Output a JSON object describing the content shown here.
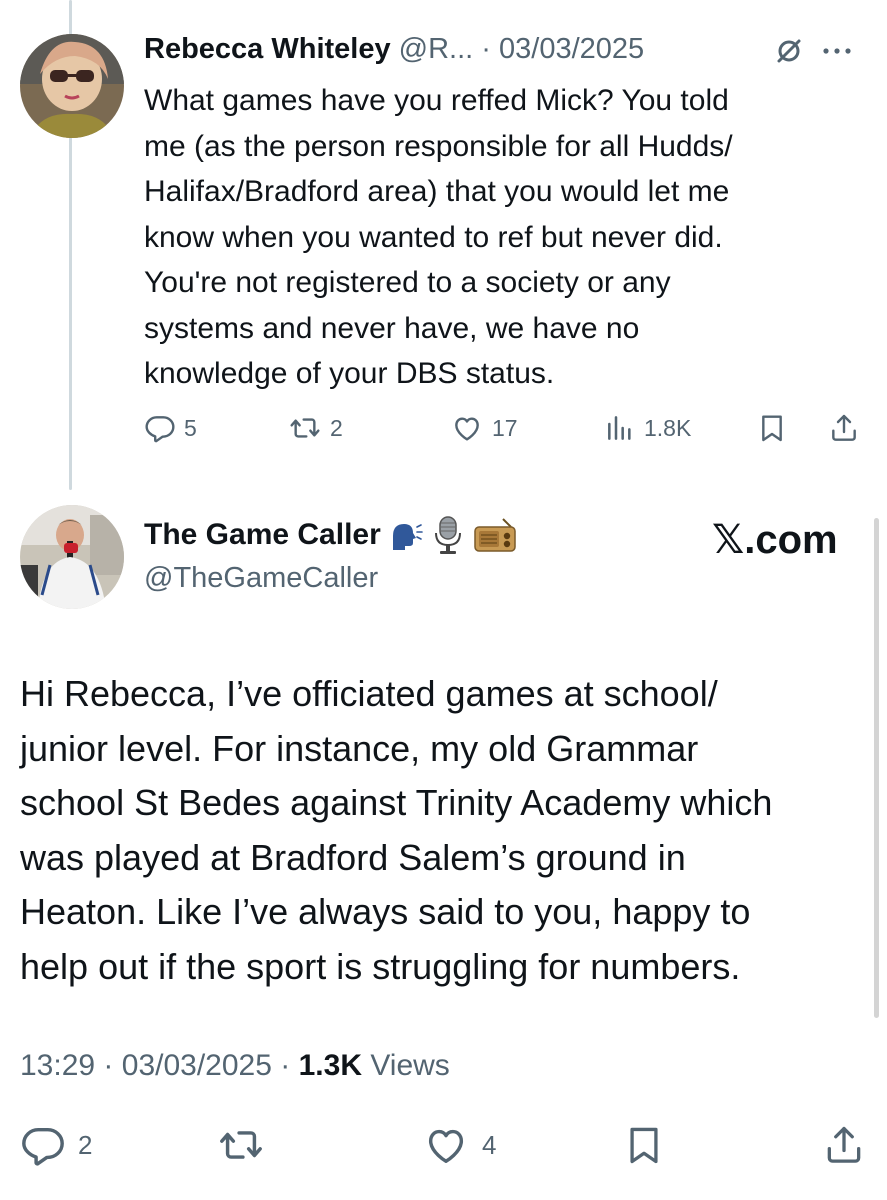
{
  "reply": {
    "author_name": "Rebecca Whiteley",
    "author_handle": "@R...",
    "separator": "·",
    "date": "03/03/2025",
    "text": "What games have you reffed Mick? You told\nme (as the person responsible for all Hudds/\nHalifax/Bradford area) that you would let me\nknow when you wanted to ref but never did.\nYou're not registered to a society or any\nsystems and never have, we have no\nknowledge of your DBS status.",
    "actions": {
      "replies": "5",
      "reposts": "2",
      "likes": "17",
      "views": "1.8K"
    }
  },
  "main": {
    "author_name": "The Game Caller",
    "author_emojis": [
      "speaking-head-emoji",
      "microphone-emoji",
      "radio-emoji"
    ],
    "author_handle": "@TheGameCaller",
    "watermark": "𝕏.com",
    "text": "Hi Rebecca, I’ve officiated games at school/\njunior level. For instance, my old Grammar\nschool St Bedes against Trinity Academy which\nwas played at Bradford Salem’s ground in\nHeaton. Like I’ve always said to you, happy to\nhelp out if the sport is struggling for numbers.",
    "time": "13:29",
    "separator": "·",
    "date": "03/03/2025",
    "views_count": "1.3K",
    "views_label": "Views",
    "actions": {
      "replies": "2",
      "likes": "4"
    }
  },
  "colors": {
    "text_primary": "#0f1419",
    "text_secondary": "#536471",
    "thread_line": "#cfd9de"
  },
  "icons": [
    "reply-icon",
    "repost-icon",
    "like-icon",
    "views-icon",
    "bookmark-icon",
    "share-icon",
    "grok-icon",
    "more-icon"
  ]
}
